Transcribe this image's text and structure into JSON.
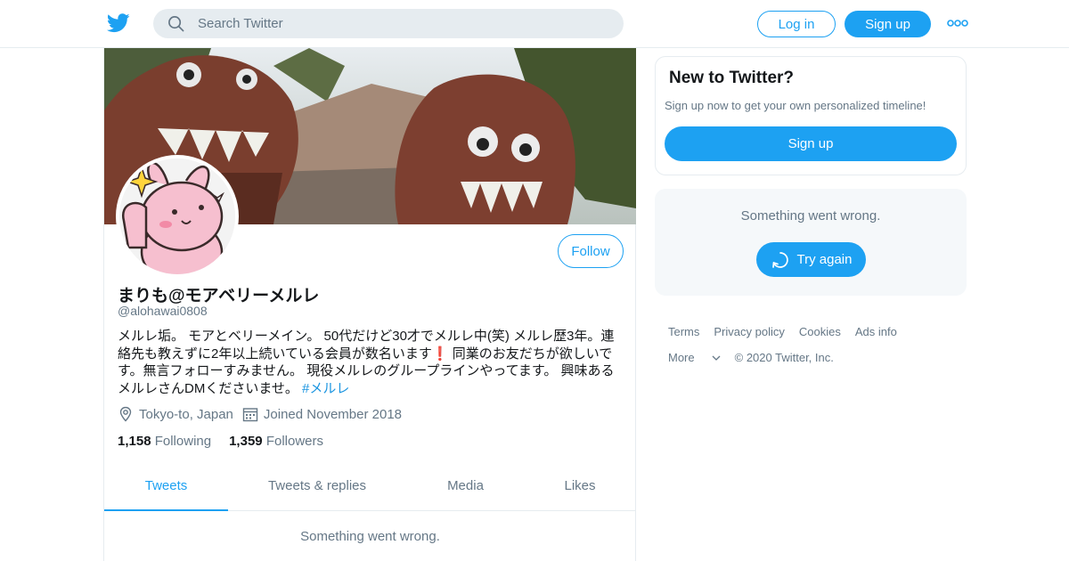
{
  "header": {
    "search_placeholder": "Search Twitter",
    "login_label": "Log in",
    "signup_label": "Sign up"
  },
  "profile": {
    "name": "まりも@モアベリーメルレ",
    "handle": "@alohawai0808",
    "bio_part1": "メルレ垢。 モアとベリーメイン。 50代だけど30才でメルレ中(笑) メルレ歴3年。連絡先も教えずに2年以上続いている会員が数名います",
    "bio_excl": "❗",
    "bio_part2": " 同業のお友だちが欲しいです。無言フォローすみません。 現役メルレのグループラインやってます。 興味あるメルレさんDMくださいませ。 ",
    "bio_hashtag": "#メルレ",
    "location": "Tokyo-to, Japan",
    "joined": "Joined November 2018",
    "following_count": "1,158",
    "following_label": "Following",
    "followers_count": "1,359",
    "followers_label": "Followers",
    "follow_label": "Follow"
  },
  "tabs": [
    {
      "label": "Tweets",
      "active": true
    },
    {
      "label": "Tweets & replies",
      "active": false
    },
    {
      "label": "Media",
      "active": false
    },
    {
      "label": "Likes",
      "active": false
    }
  ],
  "timeline": {
    "error_text": "Something went wrong."
  },
  "sidebar": {
    "new_title": "New to Twitter?",
    "new_desc": "Sign up now to get your own personalized timeline!",
    "new_signup_label": "Sign up",
    "error_text": "Something went wrong.",
    "retry_label": "Try again"
  },
  "footer": {
    "terms": "Terms",
    "privacy": "Privacy policy",
    "cookies": "Cookies",
    "ads": "Ads info",
    "more": "More",
    "copyright": "© 2020 Twitter, Inc."
  },
  "colors": {
    "accent": "#1da1f2",
    "secondary_text": "#657786",
    "border": "#e6ecf0"
  },
  "icons": [
    "twitter-bird-icon",
    "search-icon",
    "more-dots-icon",
    "location-pin-icon",
    "calendar-icon",
    "refresh-icon",
    "chevron-down-icon"
  ]
}
